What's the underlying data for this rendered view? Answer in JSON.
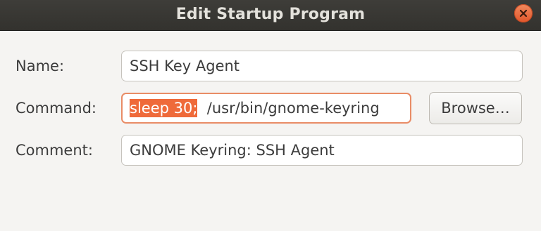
{
  "window": {
    "title": "Edit Startup Program",
    "close_icon": "close-icon",
    "accent_close": "#e9622f"
  },
  "form": {
    "name": {
      "label": "Name:",
      "value": "SSH Key Agent"
    },
    "command": {
      "label": "Command:",
      "selected_text": "sleep 30;",
      "rest_text": "  /usr/bin/gnome-keyring",
      "selection_color": "#ef6a3a"
    },
    "comment": {
      "label": "Comment:",
      "value": "GNOME Keyring: SSH Agent"
    },
    "browse_label": "Browse…"
  }
}
